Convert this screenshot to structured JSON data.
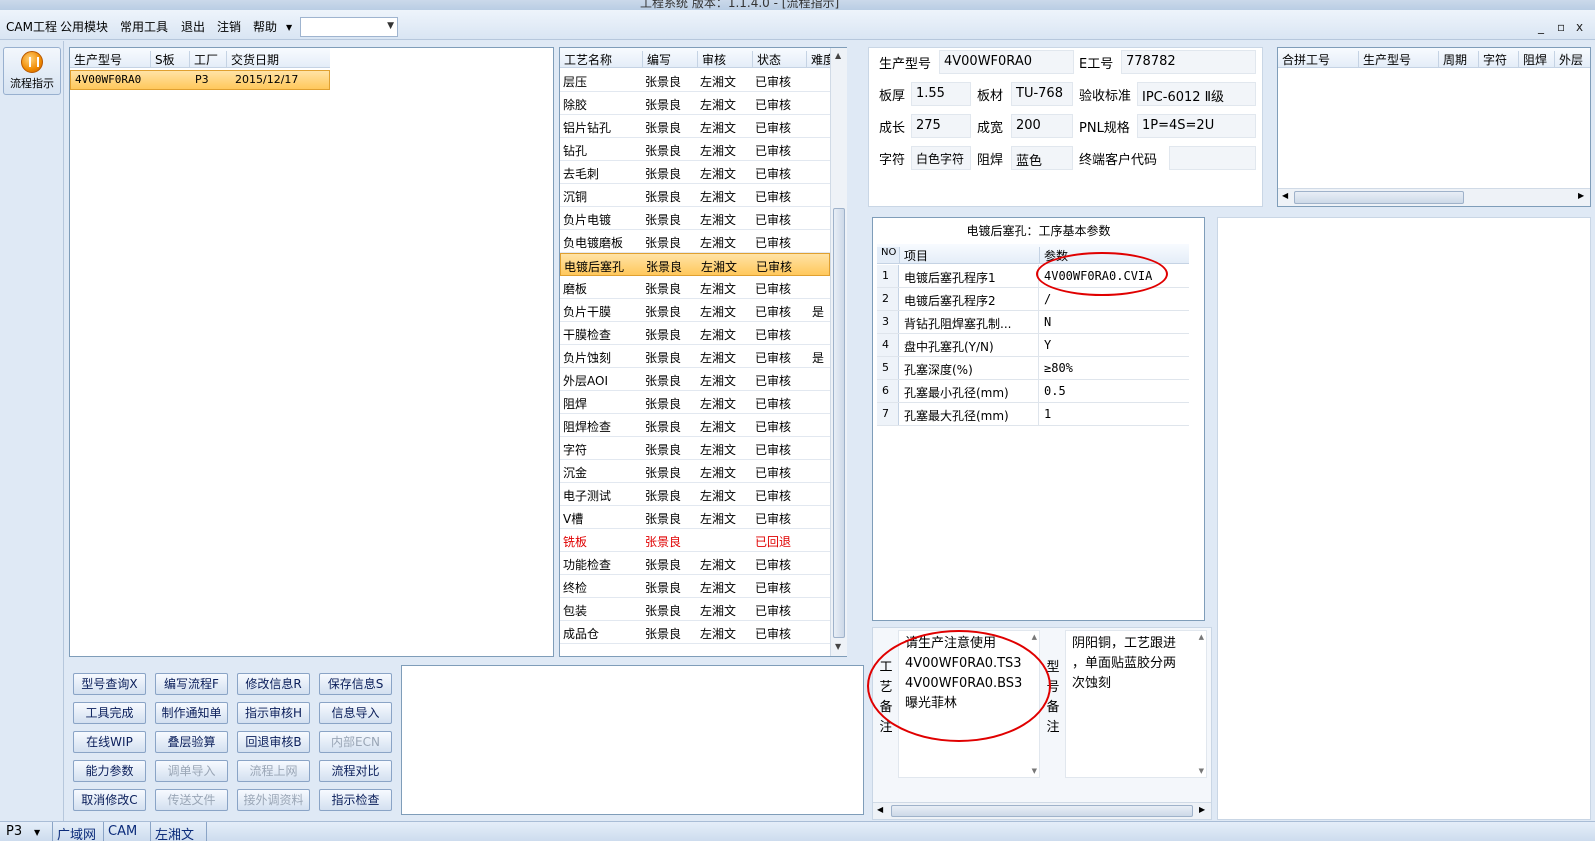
{
  "window": {
    "title": "工程系统   版本：1.1.4.0 - [流程指示]"
  },
  "menu": {
    "items": [
      "CAM工程",
      "公用模块",
      "常用工具",
      "退出",
      "注销",
      "帮助"
    ],
    "combo_value": "",
    "window_controls": [
      "_",
      "▫",
      "x"
    ]
  },
  "leftbar": {
    "flow_label": "流程指示"
  },
  "orders": {
    "headers": [
      "生产型号",
      "S板",
      "工厂",
      "交货日期"
    ],
    "rows": [
      {
        "model": "4V00WF0RA0",
        "s": "",
        "factory": "P3",
        "date": "2015/12/17"
      }
    ]
  },
  "process": {
    "headers": [
      "工艺名称",
      "编写",
      "审核",
      "状态",
      "难度"
    ],
    "rows": [
      {
        "name": "层压",
        "writer": "张景良",
        "auditor": "左湘文",
        "status": "已审核",
        "diff": ""
      },
      {
        "name": "除胶",
        "writer": "张景良",
        "auditor": "左湘文",
        "status": "已审核",
        "diff": ""
      },
      {
        "name": "铝片钻孔",
        "writer": "张景良",
        "auditor": "左湘文",
        "status": "已审核",
        "diff": ""
      },
      {
        "name": "钻孔",
        "writer": "张景良",
        "auditor": "左湘文",
        "status": "已审核",
        "diff": ""
      },
      {
        "name": "去毛刺",
        "writer": "张景良",
        "auditor": "左湘文",
        "status": "已审核",
        "diff": ""
      },
      {
        "name": "沉铜",
        "writer": "张景良",
        "auditor": "左湘文",
        "status": "已审核",
        "diff": ""
      },
      {
        "name": "负片电镀",
        "writer": "张景良",
        "auditor": "左湘文",
        "status": "已审核",
        "diff": ""
      },
      {
        "name": "负电镀磨板",
        "writer": "张景良",
        "auditor": "左湘文",
        "status": "已审核",
        "diff": ""
      },
      {
        "name": "电镀后塞孔",
        "writer": "张景良",
        "auditor": "左湘文",
        "status": "已审核",
        "diff": ""
      },
      {
        "name": "磨板",
        "writer": "张景良",
        "auditor": "左湘文",
        "status": "已审核",
        "diff": ""
      },
      {
        "name": "负片干膜",
        "writer": "张景良",
        "auditor": "左湘文",
        "status": "已审核",
        "diff": "是"
      },
      {
        "name": "干膜检查",
        "writer": "张景良",
        "auditor": "左湘文",
        "status": "已审核",
        "diff": ""
      },
      {
        "name": "负片蚀刻",
        "writer": "张景良",
        "auditor": "左湘文",
        "status": "已审核",
        "diff": "是"
      },
      {
        "name": "外层AOI",
        "writer": "张景良",
        "auditor": "左湘文",
        "status": "已审核",
        "diff": ""
      },
      {
        "name": "阻焊",
        "writer": "张景良",
        "auditor": "左湘文",
        "status": "已审核",
        "diff": ""
      },
      {
        "name": "阻焊检查",
        "writer": "张景良",
        "auditor": "左湘文",
        "status": "已审核",
        "diff": ""
      },
      {
        "name": "字符",
        "writer": "张景良",
        "auditor": "左湘文",
        "status": "已审核",
        "diff": ""
      },
      {
        "name": "沉金",
        "writer": "张景良",
        "auditor": "左湘文",
        "status": "已审核",
        "diff": ""
      },
      {
        "name": "电子测试",
        "writer": "张景良",
        "auditor": "左湘文",
        "status": "已审核",
        "diff": ""
      },
      {
        "name": "V槽",
        "writer": "张景良",
        "auditor": "左湘文",
        "status": "已审核",
        "diff": ""
      },
      {
        "name": "铣板",
        "writer": "张景良",
        "auditor": "",
        "status": "已回退",
        "diff": ""
      },
      {
        "name": "功能检查",
        "writer": "张景良",
        "auditor": "左湘文",
        "status": "已审核",
        "diff": ""
      },
      {
        "name": "终检",
        "writer": "张景良",
        "auditor": "左湘文",
        "status": "已审核",
        "diff": ""
      },
      {
        "name": "包装",
        "writer": "张景良",
        "auditor": "左湘文",
        "status": "已审核",
        "diff": ""
      },
      {
        "name": "成品仓",
        "writer": "张景良",
        "auditor": "左湘文",
        "status": "已审核",
        "diff": ""
      }
    ]
  },
  "buttons": [
    [
      {
        "label": "型号查询X",
        "enabled": true
      },
      {
        "label": "编写流程F",
        "enabled": true
      },
      {
        "label": "修改信息R",
        "enabled": true
      },
      {
        "label": "保存信息S",
        "enabled": true
      }
    ],
    [
      {
        "label": "工具完成",
        "enabled": true
      },
      {
        "label": "制作通知单",
        "enabled": true
      },
      {
        "label": "指示审核H",
        "enabled": true
      },
      {
        "label": "信息导入",
        "enabled": true
      }
    ],
    [
      {
        "label": "在线WIP",
        "enabled": true
      },
      {
        "label": "叠层验算",
        "enabled": true
      },
      {
        "label": "回退审核B",
        "enabled": true
      },
      {
        "label": "内部ECN",
        "enabled": false
      }
    ],
    [
      {
        "label": "能力参数",
        "enabled": true
      },
      {
        "label": "调单导入",
        "enabled": false
      },
      {
        "label": "流程上网",
        "enabled": false
      },
      {
        "label": "流程对比",
        "enabled": true
      }
    ],
    [
      {
        "label": "取消修改C",
        "enabled": true
      },
      {
        "label": "传送文件",
        "enabled": false
      },
      {
        "label": "接外调资料",
        "enabled": false
      },
      {
        "label": "指示检查",
        "enabled": true
      }
    ]
  ],
  "info": {
    "model_label": "生产型号",
    "model_value": "4V00WF0RA0",
    "eno_label": "E工号",
    "eno_value": "778782",
    "thick_label": "板厚",
    "thick_value": "1.55",
    "material_label": "板材",
    "material_value": "TU-768",
    "std_label": "验收标准",
    "std_value": "IPC-6012 Ⅱ级",
    "len_label": "成长",
    "len_value": "275",
    "wid_label": "成宽",
    "wid_value": "200",
    "pnl_label": "PNL规格",
    "pnl_value": "1P=4S=2U",
    "char_label": "字符",
    "char_value": "白色字符",
    "mask_label": "阻焊",
    "mask_value": "蓝色",
    "cust_label": "终端客户代码",
    "cust_value": ""
  },
  "merge": {
    "headers": [
      "合拼工号",
      "生产型号",
      "周期",
      "字符",
      "阻焊",
      "外层"
    ]
  },
  "params": {
    "title": "电镀后塞孔：工序基本参数",
    "headers": [
      "NO",
      "项目",
      "参数"
    ],
    "rows": [
      {
        "no": "1",
        "item": "电镀后塞孔程序1",
        "value": "4V00WF0RA0.CVIA"
      },
      {
        "no": "2",
        "item": "电镀后塞孔程序2",
        "value": "/"
      },
      {
        "no": "3",
        "item": "背钻孔阻焊塞孔制...",
        "value": "N"
      },
      {
        "no": "4",
        "item": "盘中孔塞孔(Y/N)",
        "value": "Y"
      },
      {
        "no": "5",
        "item": "孔塞深度(%)",
        "value": "≥80%"
      },
      {
        "no": "6",
        "item": "孔塞最小孔径(mm)",
        "value": "0.5"
      },
      {
        "no": "7",
        "item": "孔塞最大孔径(mm)",
        "value": "1"
      }
    ]
  },
  "remarks": {
    "process_label": "工艺备注",
    "process_lines": [
      "请生产注意使用",
      "4V00WF0RA0.TS3",
      "4V00WF0RA0.BS3",
      "曝光菲林"
    ],
    "model_label": "型号备注",
    "model_lines": [
      "阴阳铜，工艺跟进",
      "，单面贴蓝胶分两",
      "次蚀刻"
    ]
  },
  "statusbar": {
    "items": [
      "P3",
      "广域网",
      "CAM",
      "左湘文"
    ]
  },
  "colors": {
    "accent": "#ffc85c",
    "alert": "#e00000",
    "border": "#7f9db9"
  }
}
